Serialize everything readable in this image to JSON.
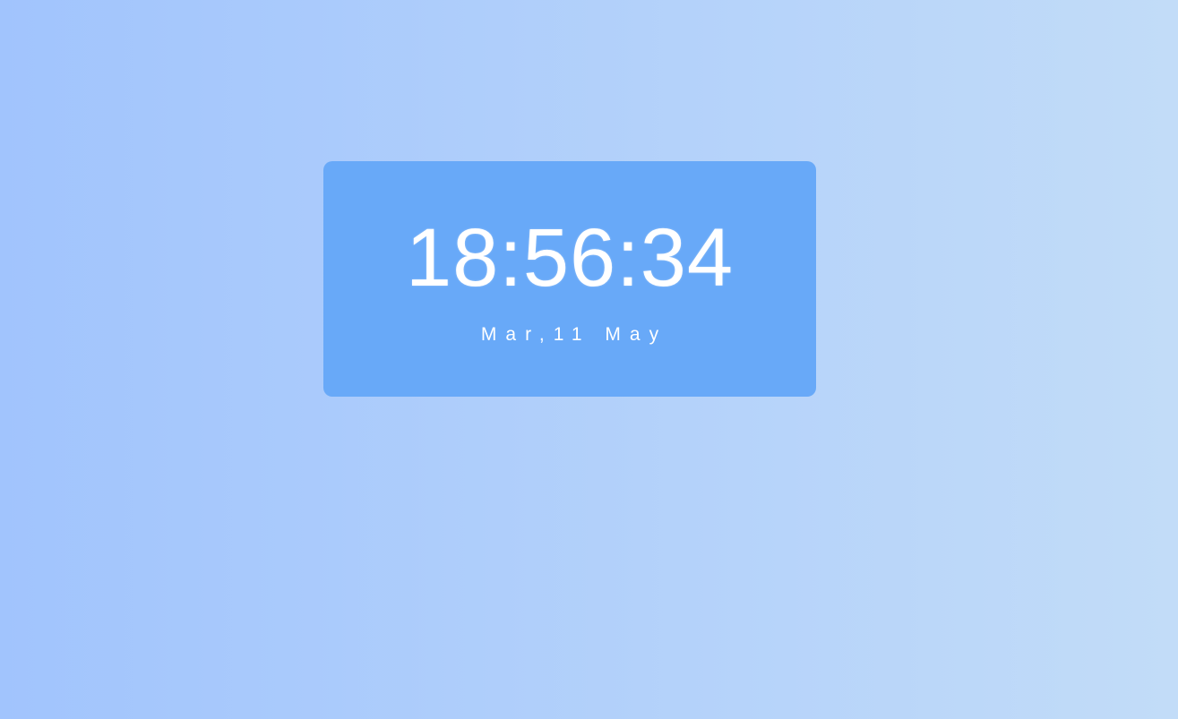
{
  "clock": {
    "time": "18:56:34",
    "date": "Mar,11 May"
  },
  "colors": {
    "background_start": "#a1c4fd",
    "background_end": "#c2dcf8",
    "card": "#68a9f8",
    "text": "#ffffff"
  }
}
